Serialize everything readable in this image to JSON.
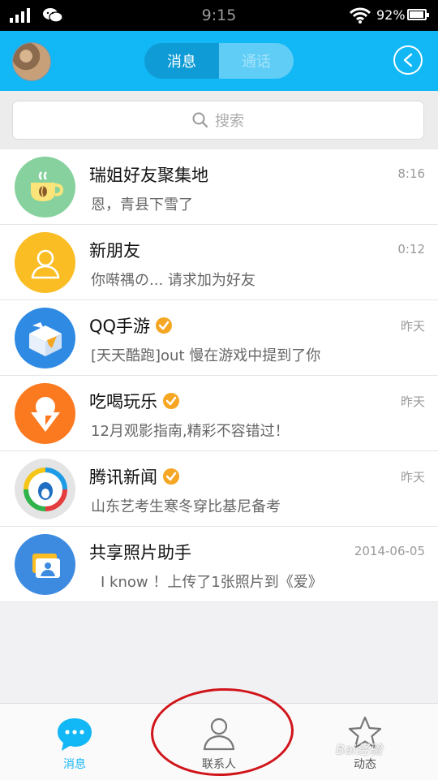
{
  "status_bar": {
    "time": "9:15",
    "battery": "92%",
    "battery_level": 0.92
  },
  "header": {
    "tab_messages": "消息",
    "tab_calls": "通话",
    "active_tab": "消息"
  },
  "search": {
    "placeholder": "搜索"
  },
  "conversations": [
    {
      "name": "瑞姐好友聚集地",
      "message": "恩，青县下雪了",
      "time": "8:16",
      "verified": false,
      "avatar_color": "#86d19e",
      "avatar_icon": "coffee-cup-icon"
    },
    {
      "name": "新朋友",
      "message": "你啭禑の... 请求加为好友",
      "time": "0:12",
      "verified": false,
      "avatar_color": "#fbbd24",
      "avatar_icon": "person-icon"
    },
    {
      "name": "QQ手游",
      "message": "[天天酷跑]out  慢在游戏中提到了你",
      "time": "昨天",
      "verified": true,
      "avatar_color": "#2f8ae3",
      "avatar_icon": "gift-box-icon"
    },
    {
      "name": "吃喝玩乐",
      "message": "12月观影指南,精彩不容错过！",
      "time": "昨天",
      "verified": true,
      "avatar_color": "#fb7a20",
      "avatar_icon": "ice-cream-icon"
    },
    {
      "name": "腾讯新闻",
      "message": "山东艺考生寒冬穿比基尼备考",
      "time": "昨天",
      "verified": true,
      "avatar_color": "#e4e4e4",
      "avatar_icon": "news-penguin-icon"
    },
    {
      "name": "共享照片助手",
      "message": "I    know ！上传了1张照片到《爱》",
      "time": "2014-06-05",
      "verified": false,
      "avatar_color": "#3d8be0",
      "avatar_icon": "photo-icon"
    }
  ],
  "bottom_nav": {
    "messages": "消息",
    "contacts": "联系人",
    "moments": "动态"
  },
  "colors": {
    "header_blue": "#12b7f5",
    "active_blue": "#12b7f5",
    "annotation_red": "#d0141a"
  },
  "watermark": "Bai经验"
}
